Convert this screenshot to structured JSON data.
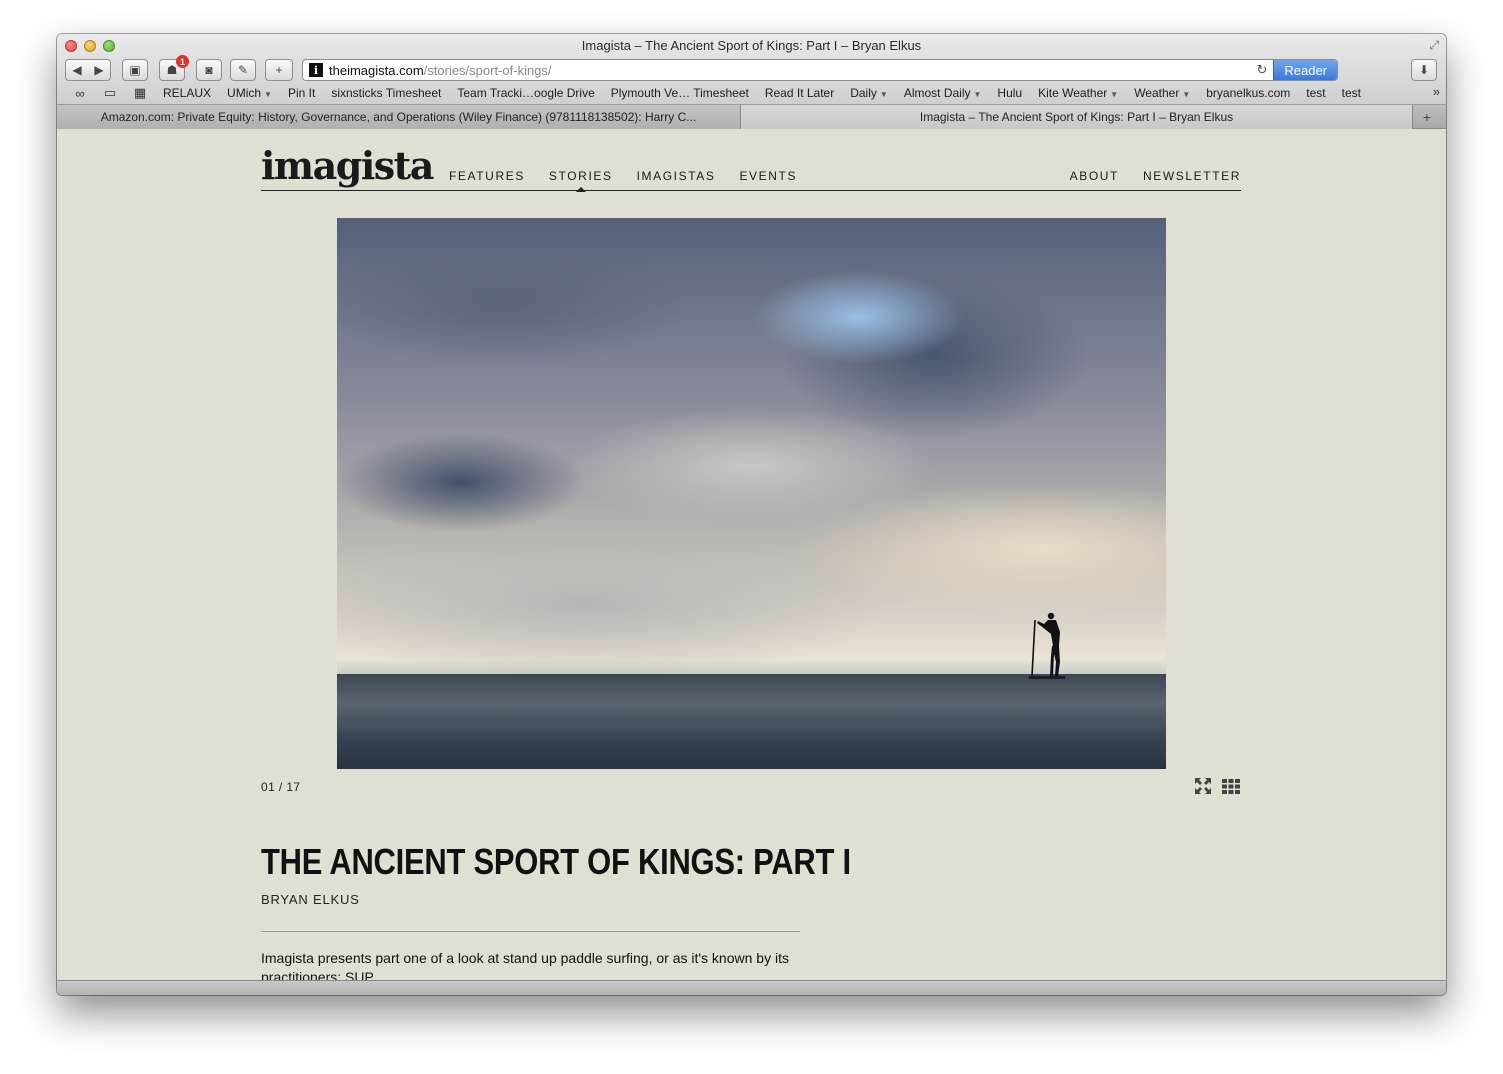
{
  "window": {
    "title": "Imagista – The Ancient Sport of Kings: Part I – Bryan Elkus"
  },
  "toolbar": {
    "badge_count": "1",
    "url_host": "theimagista.com",
    "url_path": "/stories/sport-of-kings/",
    "reader_label": "Reader"
  },
  "bookmarks": [
    {
      "label": "RELAUX",
      "menu": false
    },
    {
      "label": "UMich",
      "menu": true
    },
    {
      "label": "Pin It",
      "menu": false
    },
    {
      "label": "sixnsticks Timesheet",
      "menu": false
    },
    {
      "label": "Team Tracki…oogle Drive",
      "menu": false
    },
    {
      "label": "Plymouth Ve… Timesheet",
      "menu": false
    },
    {
      "label": "Read It Later",
      "menu": false
    },
    {
      "label": "Daily",
      "menu": true
    },
    {
      "label": "Almost Daily",
      "menu": true
    },
    {
      "label": "Hulu",
      "menu": false
    },
    {
      "label": "Kite Weather",
      "menu": true
    },
    {
      "label": "Weather",
      "menu": true
    },
    {
      "label": "bryanelkus.com",
      "menu": false
    },
    {
      "label": "test",
      "menu": false
    },
    {
      "label": "test",
      "menu": false
    }
  ],
  "tabs": [
    {
      "label": "Amazon.com: Private Equity: History, Governance, and Operations (Wiley Finance) (9781118138502): Harry C...",
      "active": false
    },
    {
      "label": "Imagista – The Ancient Sport of Kings: Part I – Bryan Elkus",
      "active": true
    }
  ],
  "site": {
    "logo": "imagista",
    "nav_left": [
      "FEATURES",
      "STORIES",
      "IMAGISTAS",
      "EVENTS"
    ],
    "nav_right": [
      "ABOUT",
      "NEWSLETTER"
    ],
    "active_nav": "STORIES"
  },
  "gallery": {
    "counter": "01 / 17"
  },
  "article": {
    "title": "THE ANCIENT SPORT OF KINGS: PART I",
    "author": "BRYAN ELKUS",
    "intro": "Imagista presents part one of a look at stand up paddle surfing, or as it's known by its practitioners: SUP"
  }
}
